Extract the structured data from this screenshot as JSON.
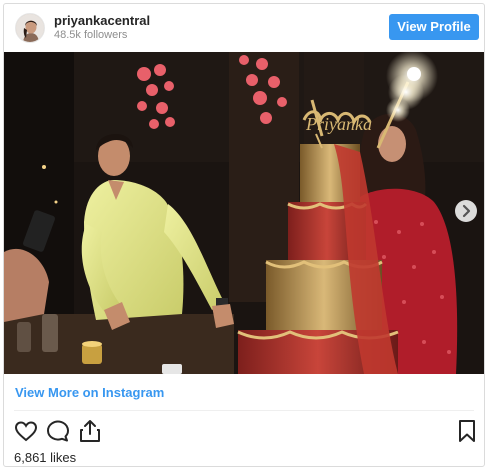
{
  "header": {
    "username": "priyankacentral",
    "followers": "48.5k followers",
    "view_profile_label": "View Profile"
  },
  "photo": {
    "cake_topper_text": "Priyanka"
  },
  "footer": {
    "view_more_label": "View More on Instagram",
    "likes": "6,861 likes"
  },
  "icons": {
    "like": "heart-icon",
    "comment": "comment-icon",
    "share": "share-icon",
    "save": "bookmark-icon",
    "next": "chevron-right-icon"
  },
  "colors": {
    "accent": "#3897f0",
    "text": "#262626",
    "muted": "#8e8e8e",
    "border": "#dbdbdb"
  }
}
